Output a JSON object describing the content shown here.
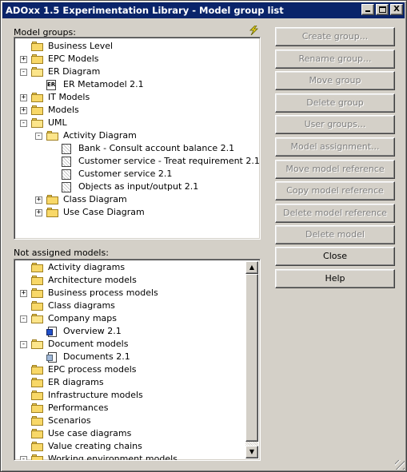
{
  "window": {
    "title": "ADOxx 1.5 Experimentation Library - Model group list",
    "minimize": "_",
    "maximize": "□",
    "close": "X"
  },
  "model_groups": {
    "label": "Model groups:",
    "items": [
      {
        "text": "Business Level",
        "type": "folder",
        "level": 0,
        "expander": ""
      },
      {
        "text": "EPC Models",
        "type": "folder",
        "level": 0,
        "expander": "+"
      },
      {
        "text": "ER Diagram",
        "type": "folder-open",
        "level": 0,
        "expander": "-"
      },
      {
        "text": "ER Metamodel 2.1",
        "type": "er-model",
        "level": 1,
        "expander": ""
      },
      {
        "text": "IT Models",
        "type": "folder",
        "level": 0,
        "expander": "+"
      },
      {
        "text": "Models",
        "type": "folder",
        "level": 0,
        "expander": "+"
      },
      {
        "text": "UML",
        "type": "folder-open",
        "level": 0,
        "expander": "-"
      },
      {
        "text": "Activity Diagram",
        "type": "folder-open",
        "level": 1,
        "expander": "-"
      },
      {
        "text": "Bank - Consult account balance 2.1",
        "type": "uml-model",
        "level": 2,
        "expander": ""
      },
      {
        "text": "Customer service - Treat requirement 2.1",
        "type": "uml-model",
        "level": 2,
        "expander": ""
      },
      {
        "text": "Customer service 2.1",
        "type": "uml-model",
        "level": 2,
        "expander": ""
      },
      {
        "text": "Objects as input/output 2.1",
        "type": "uml-model",
        "level": 2,
        "expander": ""
      },
      {
        "text": "Class Diagram",
        "type": "folder",
        "level": 1,
        "expander": "+"
      },
      {
        "text": "Use Case Diagram",
        "type": "folder",
        "level": 1,
        "expander": "+"
      }
    ]
  },
  "not_assigned": {
    "label": "Not assigned models:",
    "items": [
      {
        "text": "Activity diagrams",
        "type": "folder",
        "level": 0,
        "expander": ""
      },
      {
        "text": "Architecture models",
        "type": "folder",
        "level": 0,
        "expander": ""
      },
      {
        "text": "Business process models",
        "type": "folder",
        "level": 0,
        "expander": "+"
      },
      {
        "text": "Class diagrams",
        "type": "folder",
        "level": 0,
        "expander": ""
      },
      {
        "text": "Company maps",
        "type": "folder-open",
        "level": 0,
        "expander": "-"
      },
      {
        "text": "Overview 2.1",
        "type": "blue-model",
        "level": 1,
        "expander": ""
      },
      {
        "text": "Document models",
        "type": "folder-open",
        "level": 0,
        "expander": "-"
      },
      {
        "text": "Documents 2.1",
        "type": "doc-model",
        "level": 1,
        "expander": ""
      },
      {
        "text": "EPC process models",
        "type": "folder",
        "level": 0,
        "expander": ""
      },
      {
        "text": "ER diagrams",
        "type": "folder",
        "level": 0,
        "expander": ""
      },
      {
        "text": "Infrastructure models",
        "type": "folder",
        "level": 0,
        "expander": ""
      },
      {
        "text": "Performances",
        "type": "folder",
        "level": 0,
        "expander": ""
      },
      {
        "text": "Scenarios",
        "type": "folder",
        "level": 0,
        "expander": ""
      },
      {
        "text": "Use case diagrams",
        "type": "folder",
        "level": 0,
        "expander": ""
      },
      {
        "text": "Value creating chains",
        "type": "folder",
        "level": 0,
        "expander": ""
      },
      {
        "text": "Working environment models",
        "type": "folder",
        "level": 0,
        "expander": "-"
      }
    ]
  },
  "buttons": [
    {
      "name": "create-group-button",
      "label": "Create group...",
      "enabled": false
    },
    {
      "name": "rename-group-button",
      "label": "Rename group...",
      "enabled": false
    },
    {
      "name": "move-group-button",
      "label": "Move group",
      "enabled": false
    },
    {
      "name": "delete-group-button",
      "label": "Delete group",
      "enabled": false
    },
    {
      "name": "user-groups-button",
      "label": "User groups...",
      "enabled": false
    },
    {
      "name": "model-assignment-button",
      "label": "Model assignment...",
      "enabled": false
    },
    {
      "name": "move-model-reference-button",
      "label": "Move model reference",
      "enabled": false
    },
    {
      "name": "copy-model-reference-button",
      "label": "Copy model reference",
      "enabled": false
    },
    {
      "name": "delete-model-reference-button",
      "label": "Delete model reference",
      "enabled": false
    },
    {
      "name": "delete-model-button",
      "label": "Delete model",
      "enabled": false
    },
    {
      "name": "close-button",
      "label": "Close",
      "enabled": true
    },
    {
      "name": "help-button",
      "label": "Help",
      "enabled": true
    }
  ],
  "icons": {
    "filter": "lightning-bolt-icon",
    "scroll_up": "▲",
    "scroll_down": "▼"
  }
}
